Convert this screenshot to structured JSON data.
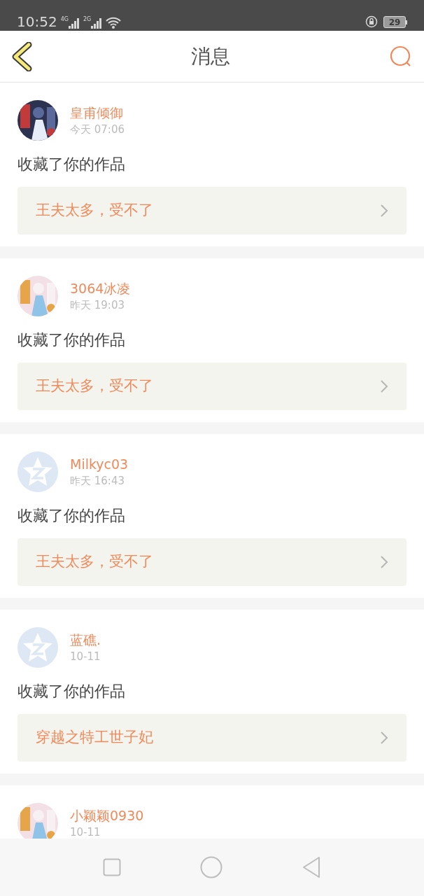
{
  "status_bar": {
    "time": "10:52",
    "network_1": "4G",
    "network_2": "2G",
    "battery": "29"
  },
  "header": {
    "title": "消息"
  },
  "messages": [
    {
      "name": "皇甫倾御",
      "time": "今天 07:06",
      "action": "收藏了你的作品",
      "work": "王夫太多，受不了"
    },
    {
      "name": "3064冰凌",
      "time": "昨天 19:03",
      "action": "收藏了你的作品",
      "work": "王夫太多，受不了"
    },
    {
      "avatar": {
        "kind": "default"
      },
      "name": "Milkyc03",
      "time": "昨天 16:43",
      "action": "收藏了你的作品",
      "work": "王夫太多，受不了"
    },
    {
      "avatar": {
        "kind": "default"
      },
      "name": "蓝礁.",
      "time": "10-11",
      "action": "收藏了你的作品",
      "work": "穿越之特工世子妃"
    },
    {
      "name": "小颖颖0930",
      "time": "10-11"
    }
  ]
}
